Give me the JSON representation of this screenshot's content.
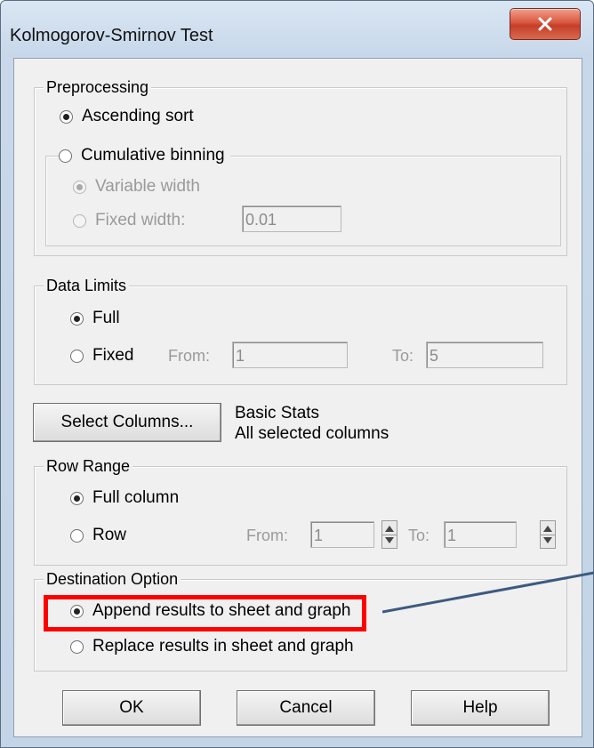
{
  "window": {
    "title": "Kolmogorov-Smirnov Test"
  },
  "preprocessing": {
    "label": "Preprocessing",
    "ascending_sort": "Ascending sort",
    "cumulative_binning": "Cumulative binning",
    "variable_width": "Variable width",
    "fixed_width": "Fixed width:",
    "fixed_width_value": "0.01"
  },
  "data_limits": {
    "label": "Data Limits",
    "full": "Full",
    "fixed": "Fixed",
    "from_label": "From:",
    "from_value": "1",
    "to_label": "To:",
    "to_value": "5"
  },
  "select_columns": {
    "button": "Select Columns...",
    "info_line1": "Basic Stats",
    "info_line2": "All selected columns"
  },
  "row_range": {
    "label": "Row Range",
    "full_column": "Full column",
    "row": "Row",
    "from_label": "From:",
    "from_value": "1",
    "to_label": "To:",
    "to_value": "1"
  },
  "destination": {
    "label": "Destination Option",
    "append": "Append results to sheet and graph",
    "replace": "Replace results in sheet and graph"
  },
  "buttons": {
    "ok": "OK",
    "cancel": "Cancel",
    "help": "Help"
  },
  "colors": {
    "highlight": "#ff0000",
    "arrow": "#3d5a80"
  },
  "icons": {
    "close": "close-icon"
  }
}
